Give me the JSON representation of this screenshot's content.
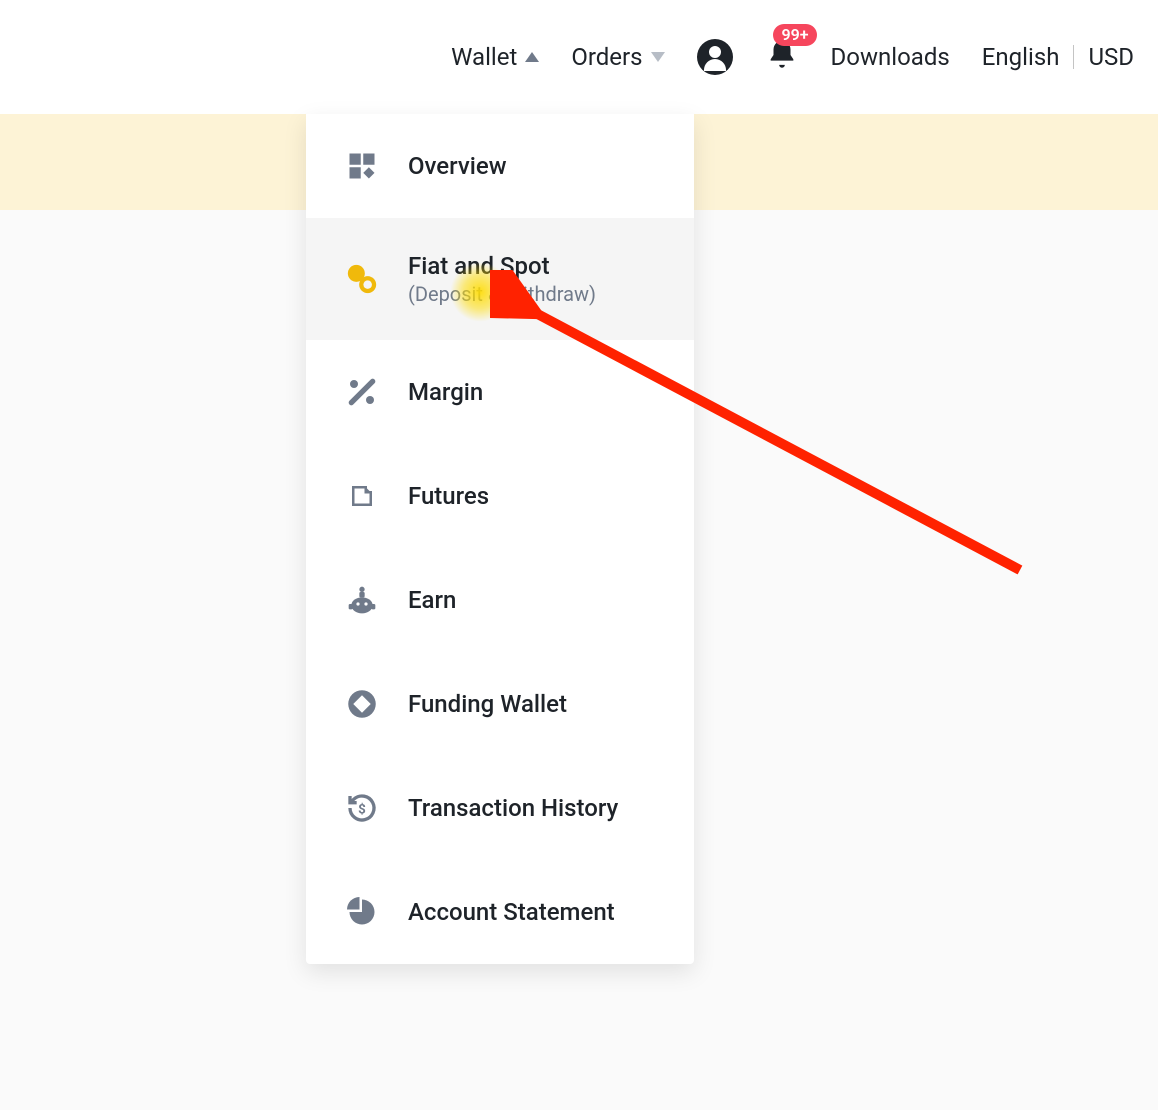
{
  "nav": {
    "wallet": "Wallet",
    "orders": "Orders",
    "downloads": "Downloads",
    "language": "English",
    "currency": "USD",
    "badge": "99+"
  },
  "menu": {
    "items": [
      {
        "label": "Overview",
        "icon": "overview"
      },
      {
        "label": "Fiat and Spot",
        "sub": "(Deposit & Withdraw)",
        "icon": "fiatspot"
      },
      {
        "label": "Margin",
        "icon": "margin"
      },
      {
        "label": "Futures",
        "icon": "futures"
      },
      {
        "label": "Earn",
        "icon": "earn"
      },
      {
        "label": "Funding Wallet",
        "icon": "funding"
      },
      {
        "label": "Transaction History",
        "icon": "history"
      },
      {
        "label": "Account Statement",
        "icon": "statement"
      }
    ]
  }
}
